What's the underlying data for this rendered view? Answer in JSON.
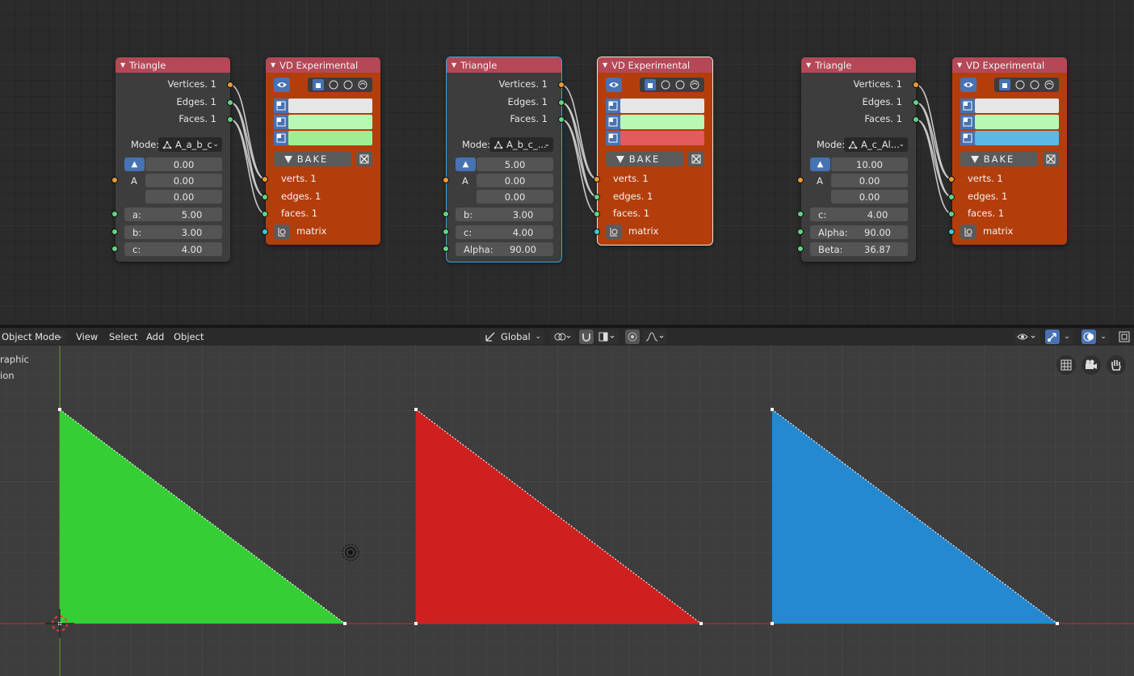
{
  "node_editor": {
    "groups": [
      {
        "triangle": {
          "title": "Triangle",
          "outputs": [
            "Vertices. 1",
            "Edges. 1",
            "Faces. 1"
          ],
          "mode_label": "Mode:",
          "mode_value": "A_a_b_c",
          "vector_label": "A",
          "vector": [
            "0.00",
            "0.00",
            "0.00"
          ],
          "params": [
            {
              "label": "a:",
              "value": "5.00"
            },
            {
              "label": "b:",
              "value": "3.00"
            },
            {
              "label": "c:",
              "value": "4.00"
            }
          ]
        },
        "vd": {
          "title": "VD Experimental",
          "swatch_colors": [
            "#e6e6e6",
            "#b9f7b2",
            "#9fee94"
          ],
          "bake_label": "BAKE",
          "inputs": [
            "verts. 1",
            "edges. 1",
            "faces. 1",
            "matrix"
          ]
        }
      },
      {
        "triangle": {
          "title": "Triangle",
          "outputs": [
            "Vertices. 1",
            "Edges. 1",
            "Faces. 1"
          ],
          "mode_label": "Mode:",
          "mode_value": "A_b_c_...",
          "vector_label": "A",
          "vector": [
            "5.00",
            "0.00",
            "0.00"
          ],
          "params": [
            {
              "label": "b:",
              "value": "3.00"
            },
            {
              "label": "c:",
              "value": "4.00"
            },
            {
              "label": "Alpha:",
              "value": "90.00"
            }
          ]
        },
        "vd": {
          "title": "VD Experimental",
          "swatch_colors": [
            "#e6e6e6",
            "#b9f7b2",
            "#e45b5b"
          ],
          "bake_label": "BAKE",
          "inputs": [
            "verts. 1",
            "edges. 1",
            "faces. 1",
            "matrix"
          ]
        }
      },
      {
        "triangle": {
          "title": "Triangle",
          "outputs": [
            "Vertices. 1",
            "Edges. 1",
            "Faces. 1"
          ],
          "mode_label": "Mode:",
          "mode_value": "A_c_Al...",
          "vector_label": "A",
          "vector": [
            "10.00",
            "0.00",
            "0.00"
          ],
          "params": [
            {
              "label": "c:",
              "value": "4.00"
            },
            {
              "label": "Alpha:",
              "value": "90.00"
            },
            {
              "label": "Beta:",
              "value": "36.87"
            }
          ]
        },
        "vd": {
          "title": "VD Experimental",
          "swatch_colors": [
            "#e6e6e6",
            "#b9f7b2",
            "#5cb8e6"
          ],
          "bake_label": "BAKE",
          "inputs": [
            "verts. 1",
            "edges. 1",
            "faces. 1",
            "matrix"
          ]
        }
      }
    ]
  },
  "viewport": {
    "header": {
      "mode": "Object Mode",
      "menus": [
        "View",
        "Select",
        "Add",
        "Object"
      ],
      "transform_orientation": "Global"
    },
    "overlay_text": [
      "raphic",
      "ion"
    ],
    "triangle_colors": [
      "#35cf35",
      "#cf2020",
      "#2589d1"
    ]
  }
}
